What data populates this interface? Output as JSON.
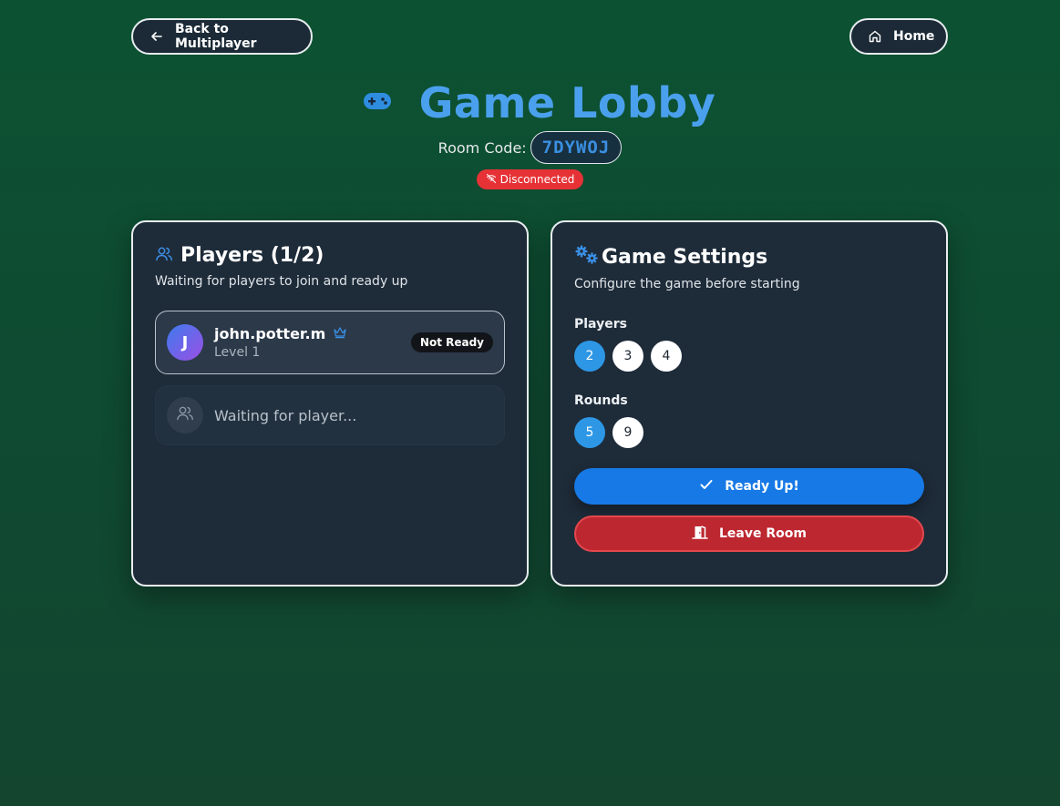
{
  "nav": {
    "back_label": "Back to Multiplayer",
    "home_label": "Home"
  },
  "header": {
    "title": "Game Lobby",
    "room_code_label": "Room Code:",
    "room_code": "7DYWOJ",
    "connection_status": "Disconnected"
  },
  "players_panel": {
    "title": "Players (1/2)",
    "subtitle": "Waiting for players to join and ready up",
    "players": [
      {
        "initial": "J",
        "name": "john.potter.m",
        "level": "Level 1",
        "status": "Not Ready",
        "is_host": true
      }
    ],
    "waiting_text": "Waiting for player..."
  },
  "settings_panel": {
    "title": "Game Settings",
    "subtitle": "Configure the game before starting",
    "players_label": "Players",
    "player_options": [
      "2",
      "3",
      "4"
    ],
    "players_selected": "2",
    "rounds_label": "Rounds",
    "round_options": [
      "5",
      "9"
    ],
    "rounds_selected": "5",
    "ready_label": "Ready Up!",
    "leave_label": "Leave Room"
  },
  "colors": {
    "accent": "#4aa0ec",
    "primary_button": "#1779e6",
    "danger_button": "#bd2730",
    "status_disconnected": "#e63236",
    "selected_option": "#2d97e6"
  },
  "icons": {
    "back": "arrow-left-icon",
    "home": "home-icon",
    "title": "gamepad-icon",
    "status": "wifi-off-icon",
    "players": "users-icon",
    "host": "crown-icon",
    "settings": "gears-icon",
    "ready": "check-icon",
    "leave": "door-exit-icon"
  }
}
